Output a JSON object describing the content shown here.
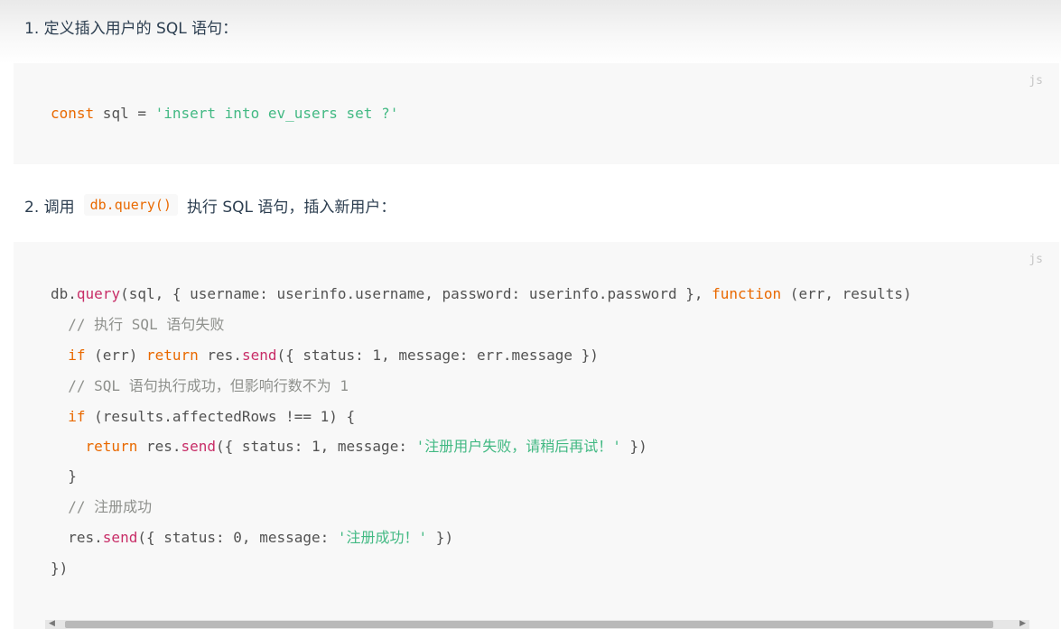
{
  "step1": {
    "text": "1. 定义插入用户的 SQL 语句："
  },
  "block1": {
    "lang": "js",
    "line1": {
      "kw": "const",
      "mid": " sql = ",
      "str": "'insert into ev_users set ?'"
    }
  },
  "step2": {
    "prefix": "2. 调用",
    "code": "db.query()",
    "suffix": "执行 SQL 语句，插入新用户："
  },
  "block2": {
    "lang": "js",
    "lines": [
      {
        "a": "db.",
        "b": "query",
        "c": "(sql, { username: userinfo.username, password: userinfo.password }, ",
        "d": "function",
        "e": " (err, results)"
      },
      {
        "cmt": "  // 执行 SQL 语句失败"
      },
      {
        "a": "  ",
        "b": "if",
        "c": " (err) ",
        "d": "return",
        "e": " res.",
        "f": "send",
        "g": "({ status: 1, message: err.message })"
      },
      {
        "cmt": "  // SQL 语句执行成功，但影响行数不为 1"
      },
      {
        "a": "  ",
        "b": "if",
        "c": " (results.affectedRows !== 1) {"
      },
      {
        "a": "    ",
        "b": "return",
        "c": " res.",
        "d": "send",
        "e": "({ status: 1, message: ",
        "f": "'注册用户失败，请稍后再试！'",
        "g": " })"
      },
      {
        "a": "  }"
      },
      {
        "cmt": "  // 注册成功"
      },
      {
        "a": "  res.",
        "b": "send",
        "c": "({ status: 0, message: ",
        "d": "'注册成功！'",
        "e": " })"
      },
      {
        "a": "})"
      }
    ]
  },
  "scrollbar": {
    "left_arrow": "◀",
    "right_arrow": "▶"
  }
}
